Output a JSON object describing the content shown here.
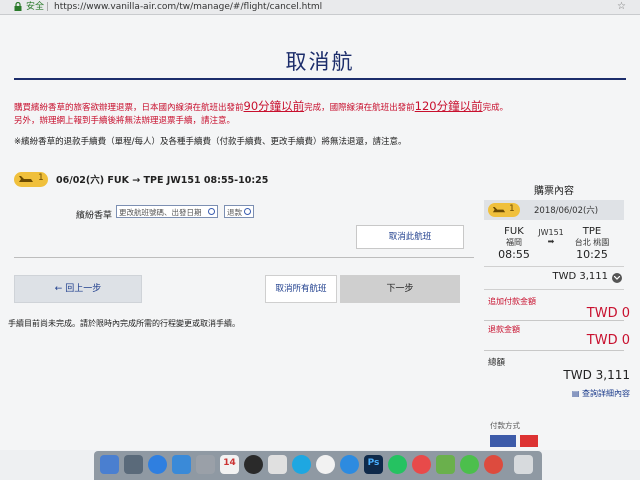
{
  "browser": {
    "secure_label": "安全",
    "url": "https://www.vanilla-air.com/tw/manage/#/flight/cancel.html"
  },
  "page": {
    "title": "取消航",
    "warning_line1_a": "購買繽紛香草的旅客欲辦理退票，日本國內線須在航班出發前",
    "warning_line1_b": "90分鐘以前",
    "warning_line1_c": "完成，國際線須在航班出發前",
    "warning_line1_d": "120分鐘以前",
    "warning_line1_e": "完成。",
    "warning_line2": "另外，辦理網上報到手續後將無法辦理退票手續，請注意。",
    "note": "※繽紛香草的退款手續費（單程/每人）及各種手續費（付款手續費、更改手續費）將無法退還，請注意。"
  },
  "flight": {
    "badge_num": "1",
    "summary": "06/02(六) FUK → TPE JW151    08:55-10:25",
    "fare_label": "繽紛香草",
    "option1": "更改航班號碼、出發日期",
    "option2": "退款",
    "cancel_button": "取消此航班"
  },
  "actions": {
    "back": "← 回上一步",
    "cancel_all": "取消所有航班",
    "next": "下一步",
    "incomplete_note": "手續目前尚未完成。請於限時內完成所需的行程變更或取消手續。"
  },
  "summary": {
    "title": "購票內容",
    "badge_num": "1",
    "date": "2018/06/02(六)",
    "from_code": "FUK",
    "from_city": "福岡",
    "from_time": "08:55",
    "flight_no": "JW151",
    "to_code": "TPE",
    "to_city": "台北 桃園",
    "to_time": "10:25",
    "price": "TWD 3,111",
    "extra_label": "追加付款金額",
    "extra_value": "TWD 0",
    "refund_label": "退款金額",
    "refund_value": "TWD 0",
    "total_label": "總額",
    "total_value": "TWD 3,111",
    "details_link": "查詢詳細內容",
    "payment_label": "付款方式"
  },
  "colors": {
    "brand_navy": "#1c2d6b",
    "warning_red": "#c8102e",
    "badge_yellow": "#f0c03c"
  },
  "dock": {
    "calendar_day": "14",
    "photoshop": "Ps"
  }
}
